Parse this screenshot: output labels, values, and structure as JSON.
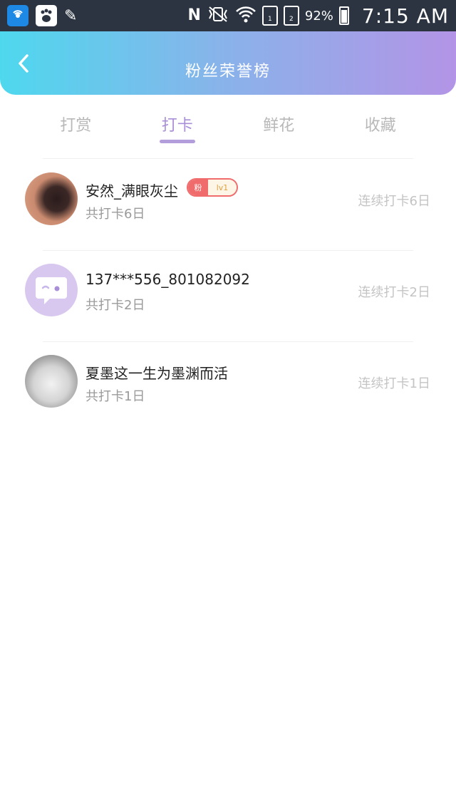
{
  "status_bar": {
    "battery": "92%",
    "time": "7:15 AM",
    "icons": [
      "wifi-key-app-icon",
      "baidu-app-icon",
      "pen-icon",
      "nfc-icon",
      "vibrate-icon",
      "wifi-icon",
      "sim1-icon",
      "sim2-icon",
      "battery-icon"
    ]
  },
  "header": {
    "title": "粉丝荣誉榜",
    "back_icon": "chevron-left-icon"
  },
  "tabs": [
    {
      "label": "打赏",
      "active": false
    },
    {
      "label": "打卡",
      "active": true
    },
    {
      "label": "鲜花",
      "active": false
    },
    {
      "label": "收藏",
      "active": false
    }
  ],
  "list": [
    {
      "name": "安然_满眼灰尘",
      "sub": "共打卡6日",
      "streak": "连续打卡6日",
      "badge": {
        "left": "粉",
        "right": "lv1"
      }
    },
    {
      "name": "137***556_801082092",
      "sub": "共打卡2日",
      "streak": "连续打卡2日"
    },
    {
      "name": "夏墨这一生为墨渊而活",
      "sub": "共打卡1日",
      "streak": "连续打卡1日"
    }
  ],
  "colors": {
    "header_gradient_start": "#4ed8ee",
    "header_gradient_end": "#b394e6",
    "tab_active": "#a98fd8",
    "tab_inactive": "#b8b8b8",
    "badge_red": "#f06c6c"
  }
}
